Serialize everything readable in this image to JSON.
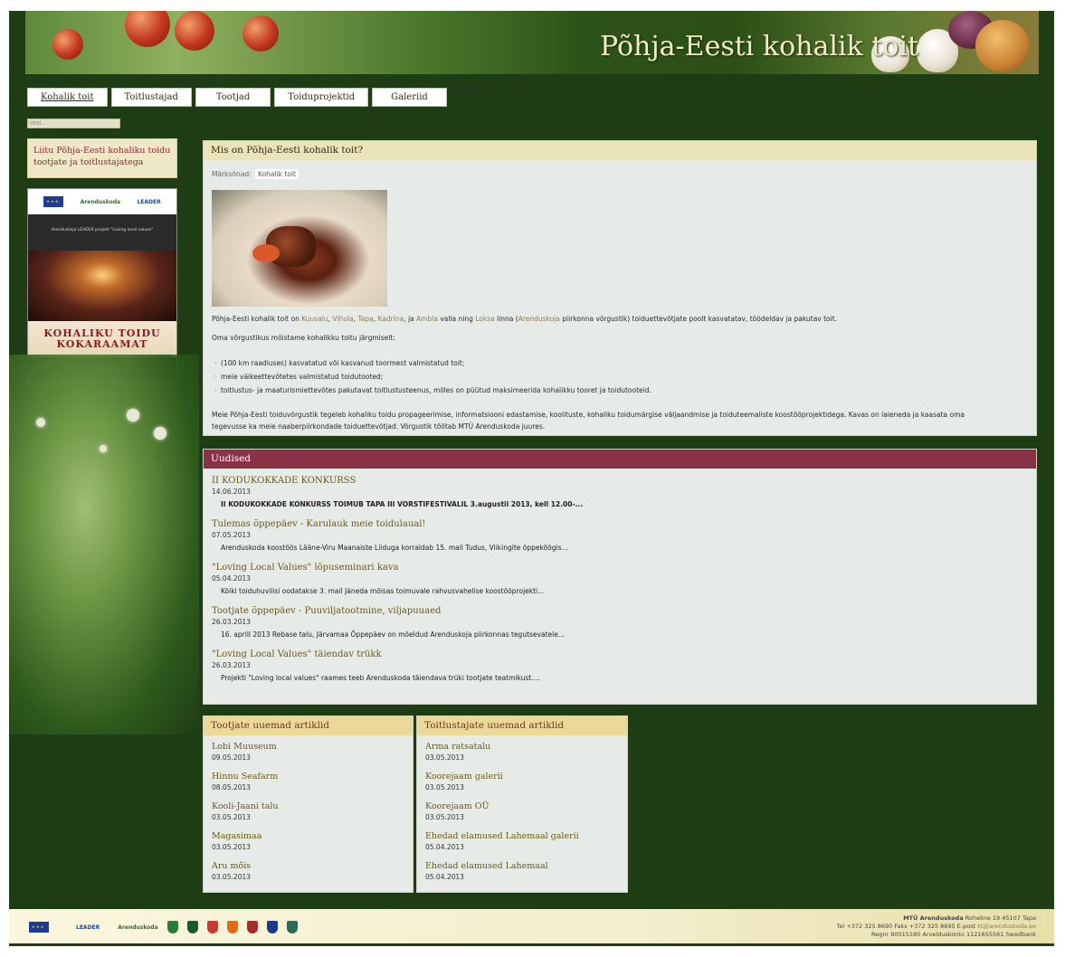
{
  "header": {
    "site_title": "Põhja-Eesti kohalik toit"
  },
  "nav": {
    "items": [
      "Kohalik toit",
      "Toitlustajad",
      "Tootjad",
      "Toiduprojektid",
      "Galeriid"
    ]
  },
  "search": {
    "placeholder": "otsi..."
  },
  "sidebar": {
    "join_text": "Liitu Põhja-Eesti kohaliku toidu tootjate ja toitlustajatega",
    "cookbook": {
      "logo_leader": "LEADER",
      "logo_arenduskoda": "Arenduskoda",
      "top_text": "Arenduskoja LEADER projekt \"Loving local values\"",
      "title_line1": "KOHALIKU TOIDU",
      "title_line2": "KOKARAAMAT"
    }
  },
  "intro": {
    "title": "Mis on Põhja-Eesti kohalik toit?",
    "keywords_label": "Märksõnad:",
    "keyword": "Kohalik toit",
    "para1": {
      "pre": "Põhja-Eesti kohalik toit on ",
      "l1": "Kuusalu",
      "s1": ", ",
      "l2": "Vihula",
      "s2": ", ",
      "l3": "Tapa",
      "s3": ", ",
      "l4": "Kadrina",
      "s4": ", ja ",
      "l5": "Ambla",
      "s5": " valla ning ",
      "l6": "Loksa",
      "s6": " linna (",
      "l7": "Arenduskoja",
      "post": " piirkonna võrgustik) toiduettevõtjate poolt kasvatatav, töödeldav ja pakutav toit."
    },
    "para2": "Oma võrgustikus mõistame kohalikku toitu järgmiselt:",
    "bullets": [
      "(100 km raadiuses) kasvatatud või kasvanud toormest valmistatud toit;",
      "meie väikeettevõtetes valmistatud toidutooted;",
      "toitlustus- ja maaturismiettevõtes pakutavat toitlustusteenus, milles on püütud maksimeerida kohalikku tooret ja toidutooteid."
    ],
    "para3_line1": "Meie Põhja-Eesti toiduvõrgustik tegeleb kohaliku toidu propageerimise, informatsiooni edastamise, koolituste, kohaliku toidumärgise väljaandmise ja toiduteemaliste koostööprojektidega. Kavas on laieneda ja kaasata oma",
    "para3_line2": "tegevusse ka meie naaberpiirkondade toiduettevõtjad. Võrgustik töötab MTÜ Arenduskoda juures."
  },
  "news": {
    "title": "Uudised",
    "items": [
      {
        "title": "II KODUKOKKADE KONKURSS",
        "date": "14.06.2013",
        "excerpt": "II KODUKOKKADE KONKURSS TOIMUB TAPA III VORSTIFESTIVALIL 3.augustil 2013, kell 12.00-..."
      },
      {
        "title": "Tulemas õppepäev - Karulauk meie toidulaual!",
        "date": "07.05.2013",
        "excerpt": "Arenduskoda koostöös Lääne-Viru Maanaiste Liiduga korraldab 15. mail Tudus, Viikingite õppeköögis..."
      },
      {
        "title": "\"Loving Local Values\" lõpuseminari kava",
        "date": "05.04.2013",
        "excerpt": "Kõiki toiduhuvilisi oodatakse 3. mail Jäneda mõisas toimuvale rahvusvahelise koostööprojekti..."
      },
      {
        "title": "Tootjate õppepäev - Puuviljatootmine, viljapuuaed",
        "date": "26.03.2013",
        "excerpt": "16. aprill 2013 Rebase talu, Järvamaa Õppepäev on mõeldud Arenduskoja piirkonnas tegutsevatele..."
      },
      {
        "title": "\"Loving Local Values\" täiendav trükk",
        "date": "26.03.2013",
        "excerpt": "Projekti \"Loving local values\" raames teeb Arenduskoda täiendava trüki tootjate teatmikust...."
      }
    ]
  },
  "producers": {
    "title": "Tootjate uuemad artiklid",
    "items": [
      {
        "title": "Lobi Muuseum",
        "date": "09.05.2013"
      },
      {
        "title": "Hinnu Seafarm",
        "date": "08.05.2013"
      },
      {
        "title": "Kooli-Jaani talu",
        "date": "03.05.2013"
      },
      {
        "title": "Magasimaa",
        "date": "03.05.2013"
      },
      {
        "title": "Aru mõis",
        "date": "03.05.2013"
      }
    ]
  },
  "caterers": {
    "title": "Toitlustajate uuemad artiklid",
    "items": [
      {
        "title": "Arma ratsatalu",
        "date": "03.05.2013"
      },
      {
        "title": "Koorejaam galerii",
        "date": "03.05.2013"
      },
      {
        "title": "Koorejaam OÜ",
        "date": "03.05.2013"
      },
      {
        "title": "Ehedad elamused Lahemaal galerii",
        "date": "05.04.2013"
      },
      {
        "title": "Ehedad elamused Lahemaal",
        "date": "05.04.2013"
      }
    ]
  },
  "footer": {
    "logo_leader": "LEADER",
    "logo_arenduskoda": "Arenduskoda",
    "line1_pre": "MTÜ Arenduskoda",
    "line1_post": " Roheline 19 45107 Tapa",
    "line2_pre": "Tel +372 325 8690 Faks +372 325 8695 E-post ",
    "line2_email": "kt@arenduskoda.ee",
    "line3": "Regnr 80015180 Arvelduskonto 1121655561 Swedbank"
  },
  "colors": {
    "background": "#1f3d14",
    "news_header": "#8a3347",
    "panel": "#e7ebe7"
  }
}
